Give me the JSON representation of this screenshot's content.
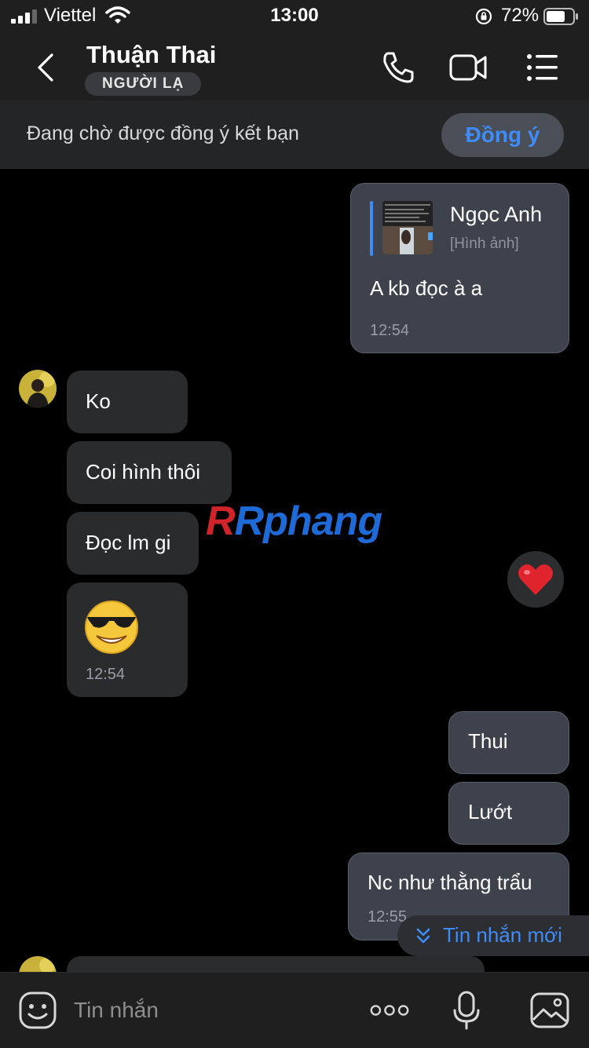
{
  "status_bar": {
    "carrier": "Viettel",
    "time": "13:00",
    "battery": "72%",
    "battery_level": 0.72
  },
  "header": {
    "contact_name": "Thuận Thai",
    "badge": "NGƯỜI LẠ"
  },
  "friend_request": {
    "text": "Đang chờ được đồng ý kết bạn",
    "button": "Đồng ý"
  },
  "messages": {
    "m1": {
      "quote_name": "Ngọc Anh",
      "quote_type": "[Hình ảnh]",
      "text": "A kb đọc à a",
      "time": "12:54"
    },
    "m2": {
      "text": "Ko"
    },
    "m3": {
      "text": "Coi hình thôi"
    },
    "m4": {
      "text": "Đọc lm gi"
    },
    "m5": {
      "emoji": "😎",
      "time": "12:54"
    },
    "reaction": "❤️",
    "m6": {
      "text": "Thui"
    },
    "m7": {
      "text": "Lướt"
    },
    "m8": {
      "text": "Nc như thằng trẩu",
      "time": "12:55"
    }
  },
  "watermark": "Rphang",
  "new_messages": "Tin nhắn mới",
  "composer": {
    "placeholder": "Tin nhắn"
  },
  "colors": {
    "accent": "#3f8cf7",
    "outgoing_bubble": "#3d424c",
    "incoming_bubble": "#2a2b2d",
    "background": "#000000"
  }
}
